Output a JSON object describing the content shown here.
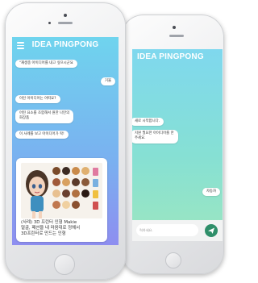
{
  "app": {
    "title": "IDEA PINGPONG"
  },
  "front_chat": {
    "messages": [
      {
        "side": "left",
        "lines": [
          "\"재생종 아이디어를 내고 싶으시군요"
        ]
      },
      {
        "side": "right",
        "lines": [
          "거울"
        ]
      },
      {
        "side": "left",
        "lines": [
          "이런 아이디어는 어떠요?"
        ]
      },
      {
        "side": "left",
        "lines": [
          "어떤 요소를 조합해서 원한 나만의",
          "화장품"
        ]
      },
      {
        "side": "left",
        "lines": [
          "이 사례를 보고 아이디어가 팍!"
        ]
      }
    ],
    "card": {
      "caption_lines": [
        "(사례) 3D 프린터 인형 Makie",
        "얼굴, 패션을 내 마음대로 정해서",
        "3D프린터로 만드는 인형"
      ]
    }
  },
  "back_chat": {
    "messages": [
      {
        "side": "left",
        "lines": [
          "새로 시작합니다."
        ]
      },
      {
        "side": "left",
        "lines": [
          "지원 필요한 아이디어를 한",
          "주세요."
        ]
      },
      {
        "side": "right",
        "lines": [
          "자동차"
        ]
      }
    ],
    "input_placeholder": "력하세요."
  },
  "colors": {
    "front_gradient": [
      "#6fd4ee",
      "#8e8ef0"
    ],
    "back_gradient": [
      "#7fd8ee",
      "#9ce6c0"
    ],
    "send_button": "#2f8f6a"
  },
  "icons": {
    "menu": "hamburger-icon",
    "send": "paper-plane-icon"
  }
}
